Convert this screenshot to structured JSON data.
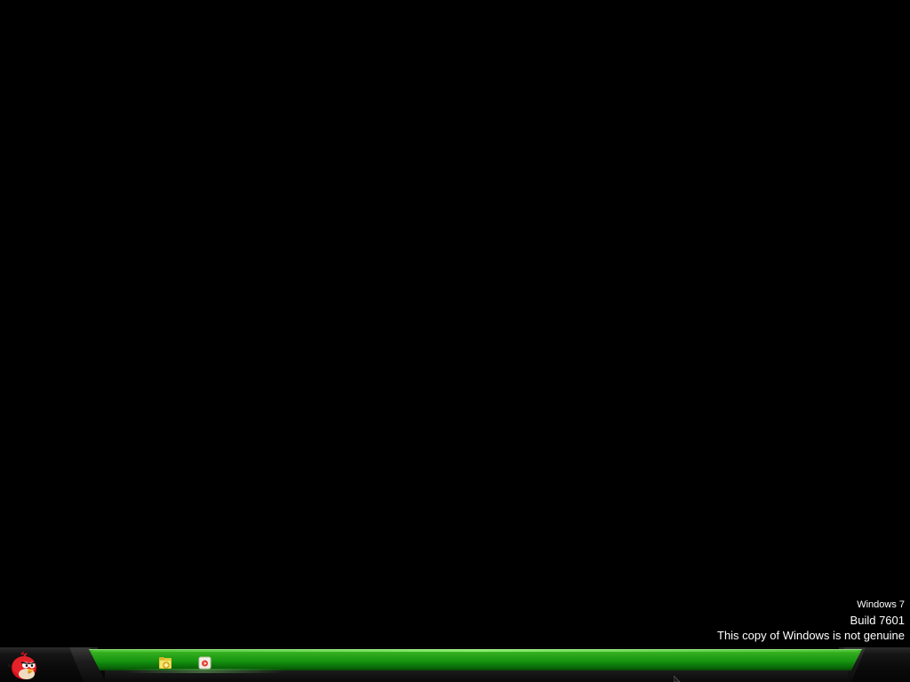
{
  "desktop": {
    "background_color": "#000000"
  },
  "watermark": {
    "os_name": "Windows 7",
    "build": "Build 7601",
    "genuine_notice": "This copy of Windows is not genuine"
  },
  "taskbar": {
    "accent_color": "#169611",
    "start_button": {
      "icon": "red-angry-bird-icon"
    },
    "pinned": [
      {
        "icon": "folder-icon",
        "app": "Windows Explorer"
      },
      {
        "icon": "media-player-icon",
        "app": "Media Player"
      }
    ]
  }
}
